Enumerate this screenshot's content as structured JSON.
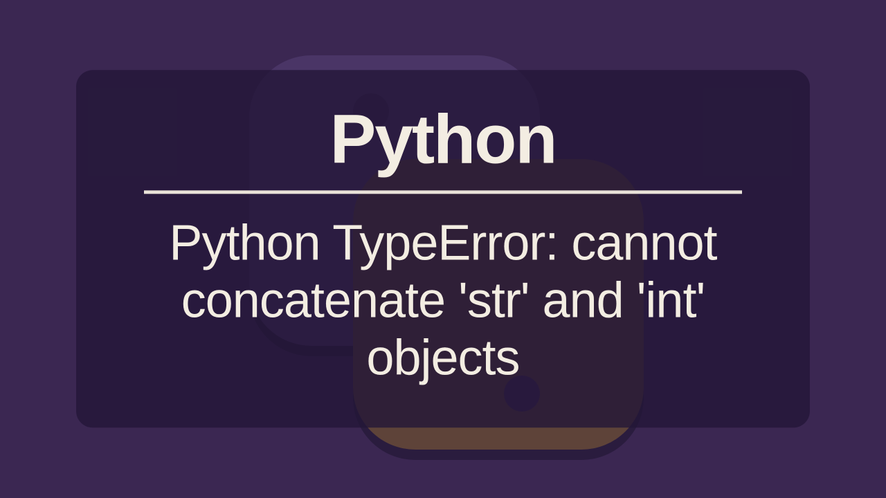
{
  "heading": "Python",
  "subtitle": "Python TypeError: cannot concatenate 'str' and 'int' objects"
}
